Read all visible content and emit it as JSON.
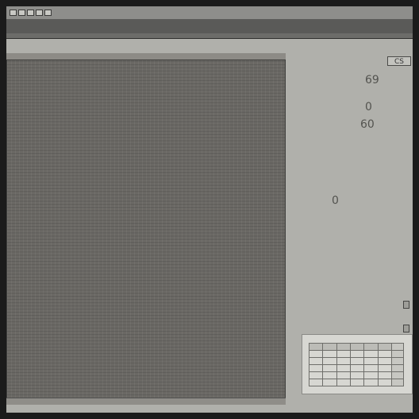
{
  "window": {
    "title_buttons": [
      "minimize-button",
      "maximize-button",
      "restore-button",
      "settings-button",
      "close-button"
    ]
  },
  "toolbar": {
    "strip_label": ""
  },
  "canvas": {
    "footer_text": ""
  },
  "side": {
    "lines": [
      "69",
      "60",
      "0",
      "0"
    ]
  },
  "badge": {
    "text": "CS"
  },
  "panel": {
    "rows": 6,
    "cols": 7
  }
}
